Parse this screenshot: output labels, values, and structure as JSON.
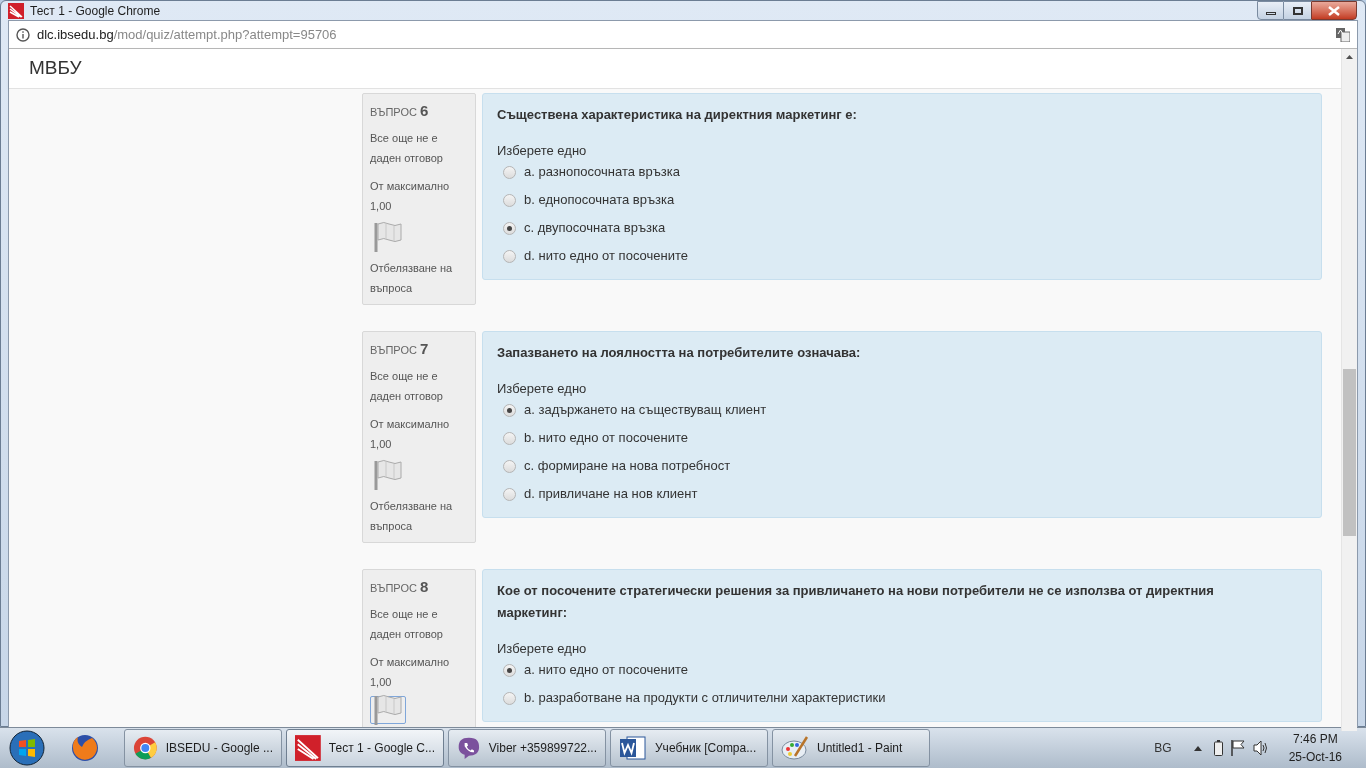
{
  "window": {
    "title": "Тест 1 - Google Chrome"
  },
  "address_bar": {
    "host": "dlc.ibsedu.bg",
    "path": "/mod/quiz/attempt.php?attempt=95706"
  },
  "site_header": {
    "title": "МВБУ"
  },
  "questions": [
    {
      "label": "ВЪПРОС",
      "number": "6",
      "status": "Все още не е даден отговор",
      "mark": "От максимално 1,00",
      "flag_label": "Отбелязване на въпроса",
      "flag_focused": false,
      "text": "Съществена характеристика на директния маркетинг е:",
      "prompt": "Изберете едно",
      "options": [
        {
          "text": "a. разнопосочната връзка",
          "selected": false
        },
        {
          "text": "b. еднопосочната връзка",
          "selected": false
        },
        {
          "text": "c. двупосочната връзка",
          "selected": true
        },
        {
          "text": "d. нито едно от посочените",
          "selected": false
        }
      ]
    },
    {
      "label": "ВЪПРОС",
      "number": "7",
      "status": "Все още не е даден отговор",
      "mark": "От максимално 1,00",
      "flag_label": "Отбелязване на въпроса",
      "flag_focused": false,
      "text": "Запазването на лоялността на потребителите означава:",
      "prompt": "Изберете едно",
      "options": [
        {
          "text": "a. задържането на съществуващ клиент",
          "selected": true
        },
        {
          "text": "b. нито едно от посочените",
          "selected": false
        },
        {
          "text": "c. формиране на нова потребност",
          "selected": false
        },
        {
          "text": "d. привличане на нов клиент",
          "selected": false
        }
      ]
    },
    {
      "label": "ВЪПРОС",
      "number": "8",
      "status": "Все още не е даден отговор",
      "mark": "От максимално 1,00",
      "flag_focused": true,
      "text": "Кое от посочените стратегически решения за привличането на нови потребители не се използва от директния маркетинг:",
      "prompt": "Изберете едно",
      "options": [
        {
          "text": "a. нито едно от посочените",
          "selected": true
        },
        {
          "text": "b. разработване на продукти с отличителни характеристики",
          "selected": false
        }
      ]
    }
  ],
  "taskbar": {
    "pinned": [
      {
        "kind": "start"
      },
      {
        "kind": "firefox"
      }
    ],
    "items": [
      {
        "kind": "chrome",
        "label": "IBSEDU - Google ...",
        "selected": false
      },
      {
        "kind": "site",
        "label": "Тест 1 - Google C...",
        "selected": true
      },
      {
        "kind": "viber",
        "label": "Viber +359899722...",
        "selected": false
      },
      {
        "kind": "word",
        "label": "Учебник [Compa...",
        "selected": false
      },
      {
        "kind": "paint",
        "label": "Untitled1 - Paint",
        "selected": false
      }
    ],
    "language": "BG",
    "time": "7:46 PM",
    "date": "25-Oct-16"
  }
}
